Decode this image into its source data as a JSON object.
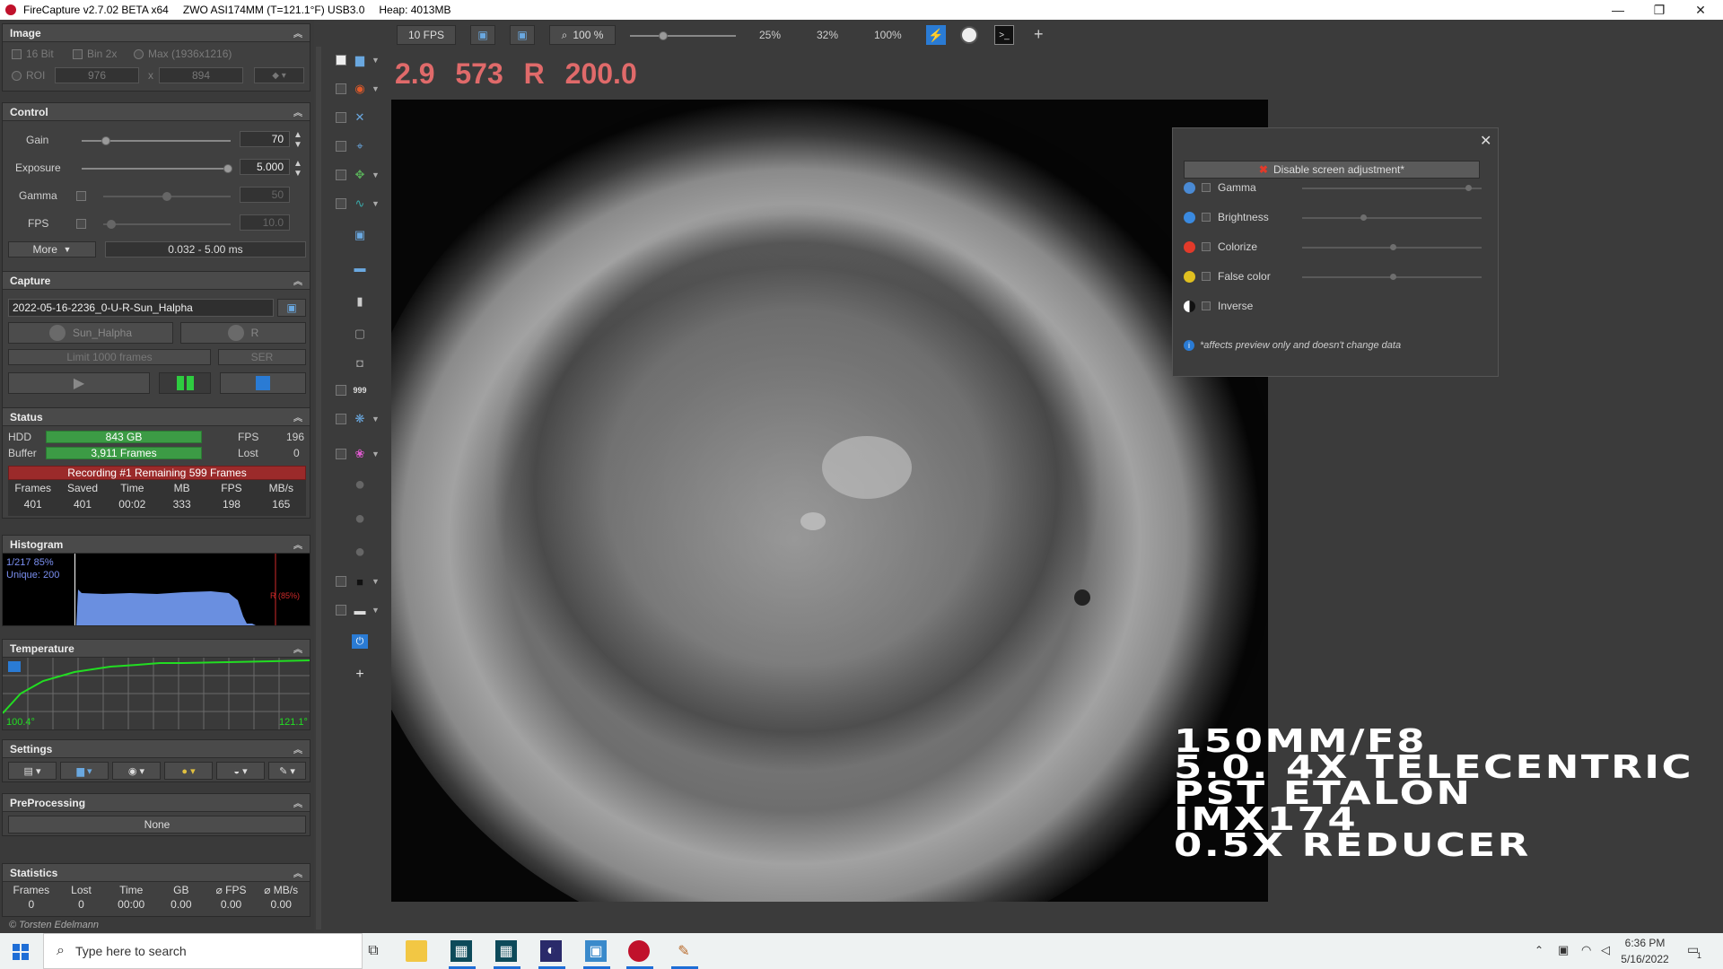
{
  "titlebar": {
    "app": "FireCapture v2.7.02 BETA x64",
    "camera": "ZWO ASI174MM (T=121.1°F) USB3.0",
    "heap": "Heap: 4013MB",
    "minimize": "—",
    "maximize": "❐",
    "close": "✕"
  },
  "image": {
    "title": "Image",
    "bit16": "16 Bit",
    "bin2x": "Bin 2x",
    "max": "Max (1936x1216)",
    "roi": "ROI",
    "roi_w": "976",
    "roi_x": "x",
    "roi_h": "894"
  },
  "control": {
    "title": "Control",
    "gain_label": "Gain",
    "gain_value": "70",
    "exposure_label": "Exposure",
    "exposure_value": "5.000",
    "gamma_label": "Gamma",
    "gamma_value": "50",
    "fps_label": "FPS",
    "fps_value": "10.0",
    "more": "More",
    "range": "0.032 - 5.00 ms"
  },
  "capture": {
    "title": "Capture",
    "filename": "2022-05-16-2236_0-U-R-Sun_Halpha",
    "profile": "Sun_Halpha",
    "filter": "R",
    "limit": "Limit 1000 frames",
    "format": "SER"
  },
  "status": {
    "title": "Status",
    "hdd_label": "HDD",
    "hdd_value": "843 GB",
    "hdd_fill": 1.0,
    "buffer_label": "Buffer",
    "buffer_value": "3,911 Frames",
    "buffer_fill": 1.0,
    "fps_label": "FPS",
    "fps_value": "196",
    "lost_label": "Lost",
    "lost_value": "0",
    "recording": "Recording #1  Remaining  599 Frames",
    "headers": [
      "Frames",
      "Saved",
      "Time",
      "MB",
      "FPS",
      "MB/s"
    ],
    "values": [
      "401",
      "401",
      "00:02",
      "333",
      "198",
      "165"
    ]
  },
  "histogram": {
    "title": "Histogram",
    "info1": "1/217 85%",
    "info2": "Unique: 200",
    "marker": "R (85%)"
  },
  "temperature": {
    "title": "Temperature",
    "min": "100.4°",
    "max": "121.1°"
  },
  "settings": {
    "title": "Settings"
  },
  "preprocessing": {
    "title": "PreProcessing",
    "value": "None"
  },
  "statistics": {
    "title": "Statistics",
    "headers": [
      "Frames",
      "Lost",
      "Time",
      "GB",
      "⌀ FPS",
      "⌀ MB/s"
    ],
    "values": [
      "0",
      "0",
      "00:00",
      "0.00",
      "0.00",
      "0.00"
    ]
  },
  "copyright": "© Torsten Edelmann",
  "toolbar": {
    "fps": "10 FPS",
    "zoom": "100 %",
    "z25": "25%",
    "z32": "32%",
    "z100": "100%",
    "add": "+"
  },
  "readout": {
    "a": "2.9",
    "b": "573",
    "c": "R",
    "d": "200.0",
    "color": "#e06a6a"
  },
  "adjust": {
    "disable": "Disable screen adjustment*",
    "close": "✕",
    "rows": [
      {
        "label": "Gamma",
        "level": 0.93
      },
      {
        "label": "Brightness",
        "level": 0.33
      },
      {
        "label": "Colorize",
        "level": 0.5
      },
      {
        "label": "False color",
        "level": 0.5
      },
      {
        "label": "Inverse"
      }
    ],
    "note": "*affects preview only and doesn't change data"
  },
  "overlay_text": "150MM/F8\n5.0. 4X TELECENTRIC\nPST ETALON\nIMX174\n0.5X REDUCER",
  "taskbar": {
    "search_placeholder": "Type here to search",
    "time": "6:36 PM",
    "date": "5/16/2022",
    "notifications": "1"
  },
  "colors": {
    "accent_green": "#3c9b45",
    "recording_red": "#9b2a2a",
    "histogram_blue": "#6a8fe0",
    "temp_green": "#22dd22"
  }
}
